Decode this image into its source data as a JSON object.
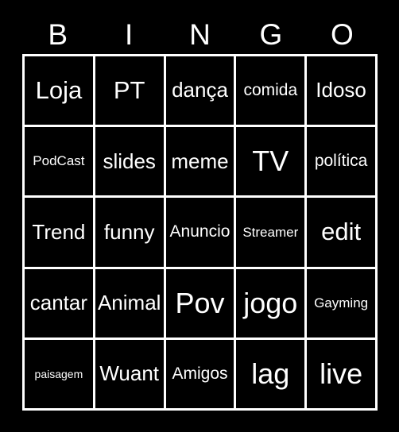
{
  "card": {
    "title": "BINGO",
    "background_color": "#000000",
    "text_color": "#ffffff",
    "grid_line_color": "#ffffff"
  },
  "header": {
    "letters": [
      "B",
      "I",
      "N",
      "G",
      "O"
    ]
  },
  "grid": {
    "columns": 5,
    "rows": 5,
    "rows_data": [
      {
        "cells": [
          {
            "text": "Loja",
            "size": "s-lg"
          },
          {
            "text": "PT",
            "size": "s-lg"
          },
          {
            "text": "dança",
            "size": "s-md"
          },
          {
            "text": "comida",
            "size": "s-sm"
          },
          {
            "text": "Idoso",
            "size": "s-md"
          }
        ]
      },
      {
        "cells": [
          {
            "text": "PodCast",
            "size": "s-xs"
          },
          {
            "text": "slides",
            "size": "s-md"
          },
          {
            "text": "meme",
            "size": "s-md"
          },
          {
            "text": "TV",
            "size": "s-xl"
          },
          {
            "text": "política",
            "size": "s-sm"
          }
        ]
      },
      {
        "cells": [
          {
            "text": "Trend",
            "size": "s-md"
          },
          {
            "text": "funny",
            "size": "s-md"
          },
          {
            "text": "Anuncio",
            "size": "s-sm"
          },
          {
            "text": "Streamer",
            "size": "s-xs"
          },
          {
            "text": "edit",
            "size": "s-lg"
          }
        ]
      },
      {
        "cells": [
          {
            "text": "cantar",
            "size": "s-md"
          },
          {
            "text": "Animal",
            "size": "s-md"
          },
          {
            "text": "Pov",
            "size": "s-xl"
          },
          {
            "text": "jogo",
            "size": "s-xl"
          },
          {
            "text": "Gayming",
            "size": "s-xs"
          }
        ]
      },
      {
        "cells": [
          {
            "text": "paisagem",
            "size": "s-xxs"
          },
          {
            "text": "Wuant",
            "size": "s-md"
          },
          {
            "text": "Amigos",
            "size": "s-sm"
          },
          {
            "text": "lag",
            "size": "s-xl"
          },
          {
            "text": "live",
            "size": "s-xl"
          }
        ]
      }
    ]
  }
}
